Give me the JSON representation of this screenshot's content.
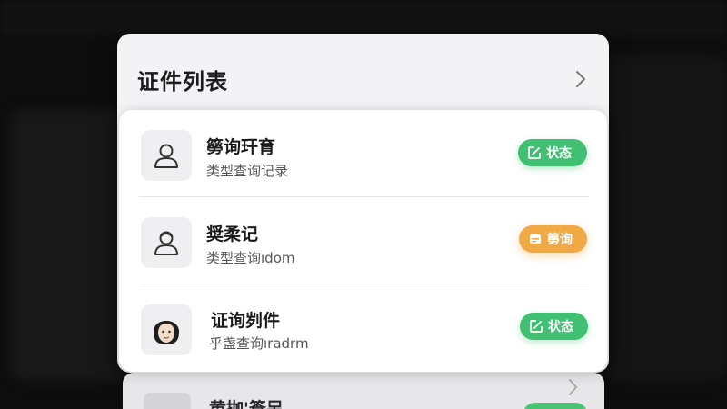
{
  "panel": {
    "title": "证件列表"
  },
  "items": [
    {
      "name": "簩询玕育",
      "subtitle": "类型查询记录",
      "avatar_icon": "person-outline-icon",
      "badge": {
        "label": "状态",
        "icon": "edit-square-icon",
        "color": "#41bf72"
      }
    },
    {
      "name": "奨柔记",
      "subtitle": "类型查询ıdom",
      "avatar_icon": "person-outline-icon",
      "badge": {
        "label": "簩询",
        "icon": "card-icon",
        "color": "#f0a945"
      }
    },
    {
      "name": "证询刿件",
      "subtitle": "乎盏查询ıradrm",
      "avatar_icon": "person-photo-icon",
      "badge": {
        "label": "状态",
        "icon": "edit-square-icon",
        "color": "#41bf72"
      }
    }
  ],
  "peek_item": {
    "name": "黄拁'篬另"
  }
}
